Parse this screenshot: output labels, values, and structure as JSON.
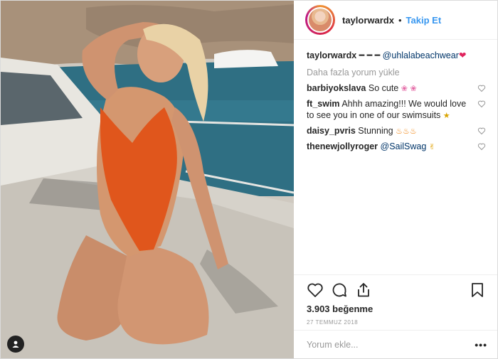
{
  "post": {
    "username": "taylorwardx",
    "follow_label": "Takip Et",
    "separator": "•"
  },
  "caption": {
    "username": "taylorwardx",
    "text_prefix": "━ ━ ━",
    "mention": "@uhlalabeachwear",
    "suffix": "❤"
  },
  "load_more_label": "Daha fazla yorum yükle",
  "comments": [
    {
      "user": "barbiyokslava",
      "text": "So cute",
      "emoji": "❀ ❀"
    },
    {
      "user": "ft_swim",
      "text": "Ahhh amazing!!! We would love to see you in one of our swimsuits",
      "emoji": "★"
    },
    {
      "user": "daisy_pvris",
      "text": "Stunning",
      "emoji": "♨♨♨"
    },
    {
      "user": "thenewjollyroger",
      "text": "@SailSwag",
      "emoji": "✌"
    }
  ],
  "likes_label": "3.903 beğenme",
  "date_label": "27 TEMMUZ 2018",
  "add_comment_placeholder": "Yorum ekle...",
  "more_label": "•••",
  "colors": {
    "link": "#3897f0",
    "mention": "#003569",
    "muted": "#999999"
  },
  "icons": [
    "heart-icon",
    "comment-icon",
    "share-icon",
    "bookmark-icon",
    "user-tag-icon"
  ]
}
